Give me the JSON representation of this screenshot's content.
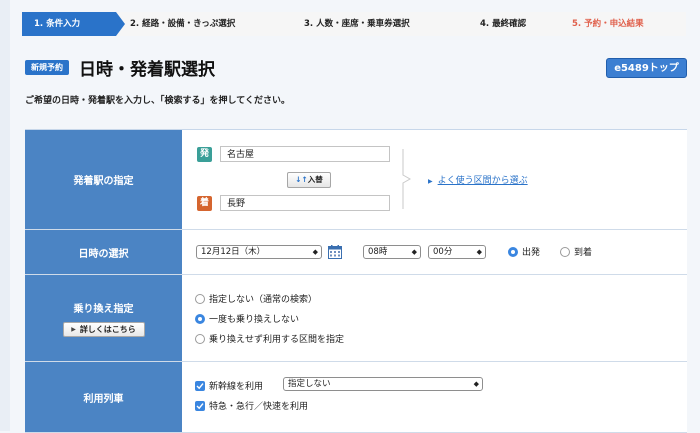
{
  "steps": [
    {
      "label": "1. 条件入力",
      "state": "active"
    },
    {
      "label": "2. 経路・設備・きっぷ選択",
      "state": "todo"
    },
    {
      "label": "3. 人数・座席・乗車券選択",
      "state": "todo"
    },
    {
      "label": "4. 最終確認",
      "state": "todo"
    },
    {
      "label": "5. 予約・申込結果",
      "state": "final"
    }
  ],
  "header": {
    "badge": "新規予約",
    "title": "日時・発着駅選択",
    "top_button": "e5489トップ"
  },
  "instruction": "ご希望の日時・発着駅を入力し、「検索する」を押してください。",
  "stations": {
    "label": "発着駅の指定",
    "departure_icon": "発",
    "departure_value": "名古屋",
    "arrival_icon": "着",
    "arrival_value": "長野",
    "swap_icon": "↓↑",
    "swap_label": "入替",
    "frequent_link": "よく使う区間から選ぶ"
  },
  "datetime": {
    "label": "日時の選択",
    "date": "12月12日（木）",
    "hour": "08時",
    "minute": "00分",
    "depart_label": "出発",
    "arrive_label": "到着",
    "selected": "depart"
  },
  "transfer": {
    "label": "乗り換え指定",
    "detail_button": "詳しくはこちら",
    "options": [
      "指定しない（通常の検索）",
      "一度も乗り換えしない",
      "乗り換えせず利用する区間を指定"
    ],
    "selected_index": 1
  },
  "trains": {
    "label": "利用列車",
    "shinkansen_label": "新幹線を利用",
    "shinkansen_checked": true,
    "shinkansen_select": "指定しない",
    "express_label": "特急・急行／快速を利用",
    "express_checked": true
  },
  "colors": {
    "primary": "#2a73c9",
    "label_bg": "#4b84c4",
    "departure": "#3a9f98",
    "arrival": "#d5652f",
    "final_step": "#e0604c"
  }
}
